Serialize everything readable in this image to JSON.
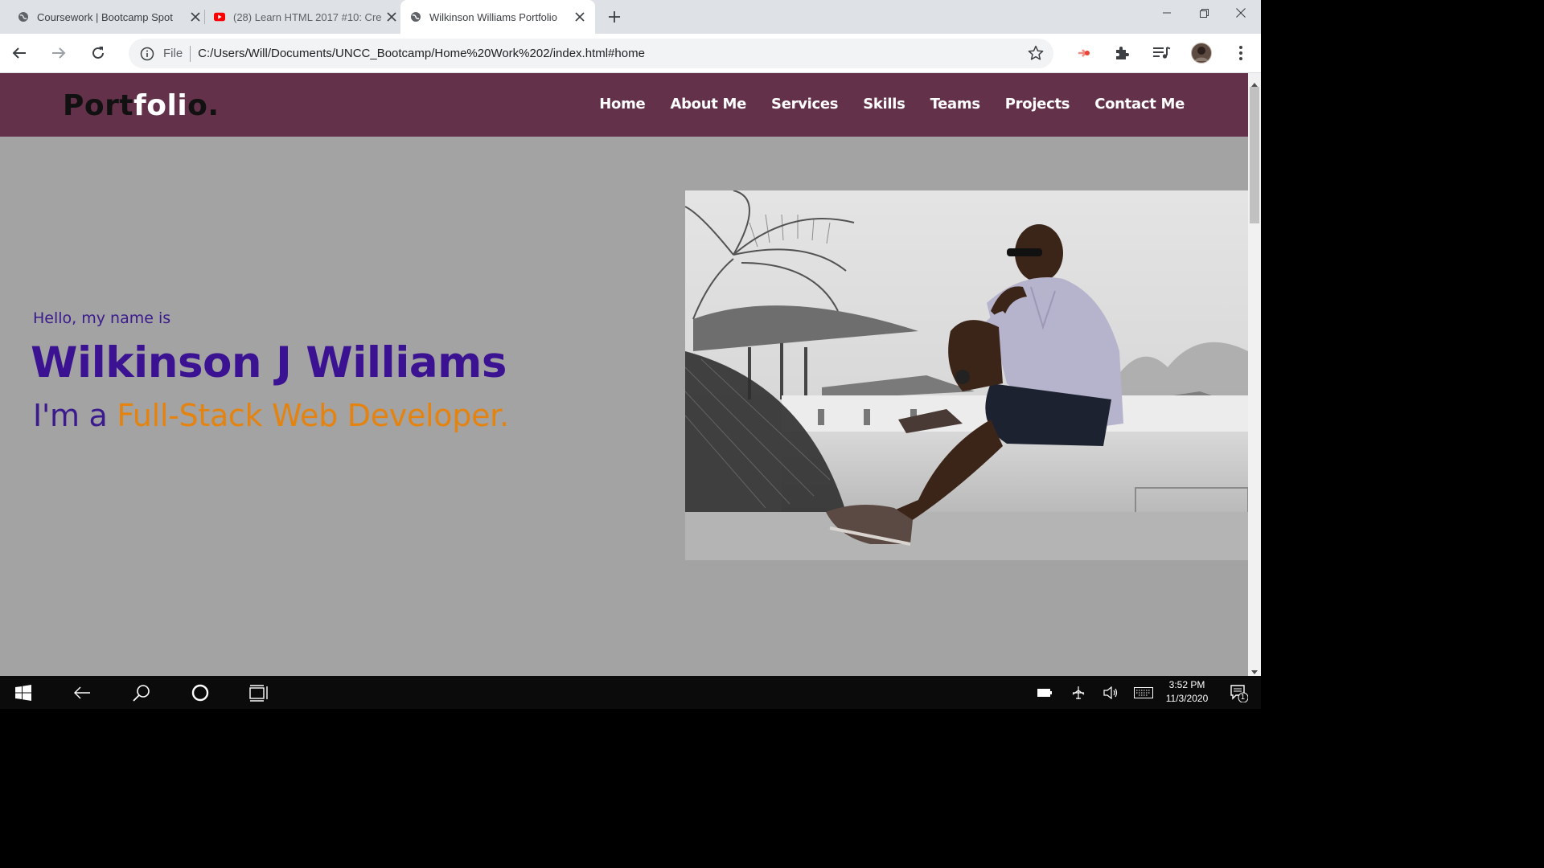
{
  "browser": {
    "tabs": [
      {
        "title": "Coursework | Bootcamp Spot",
        "favicon": "globe-icon",
        "active": false
      },
      {
        "title": "(28) Learn HTML 2017 #10: Cre",
        "favicon": "youtube-icon",
        "active": false
      },
      {
        "title": "Wilkinson Williams Portfolio",
        "favicon": "globe-icon",
        "active": true
      }
    ],
    "omnibox": {
      "scheme_label": "File",
      "url": "C:/Users/Will/Documents/UNCC_Bootcamp/Home%20Work%202/index.html#home"
    }
  },
  "page": {
    "logo": {
      "part1": "Port",
      "part2": "foli",
      "part3": "o."
    },
    "nav": [
      "Home",
      "About Me",
      "Services",
      "Skills",
      "Teams",
      "Projects",
      "Contact Me"
    ],
    "hero": {
      "greeting": "Hello, my name is",
      "name": "Wilkinson J Williams",
      "role_prefix": "I'm a ",
      "role_accent": "Full-Stack Web Developer."
    },
    "colors": {
      "navbar": "#63324a",
      "hero_bg": "#a3a3a3",
      "name_purple": "#3b1291",
      "accent_orange": "#e4830f"
    }
  },
  "taskbar": {
    "time": "3:52 PM",
    "date": "11/3/2020",
    "notification_count": "1"
  }
}
